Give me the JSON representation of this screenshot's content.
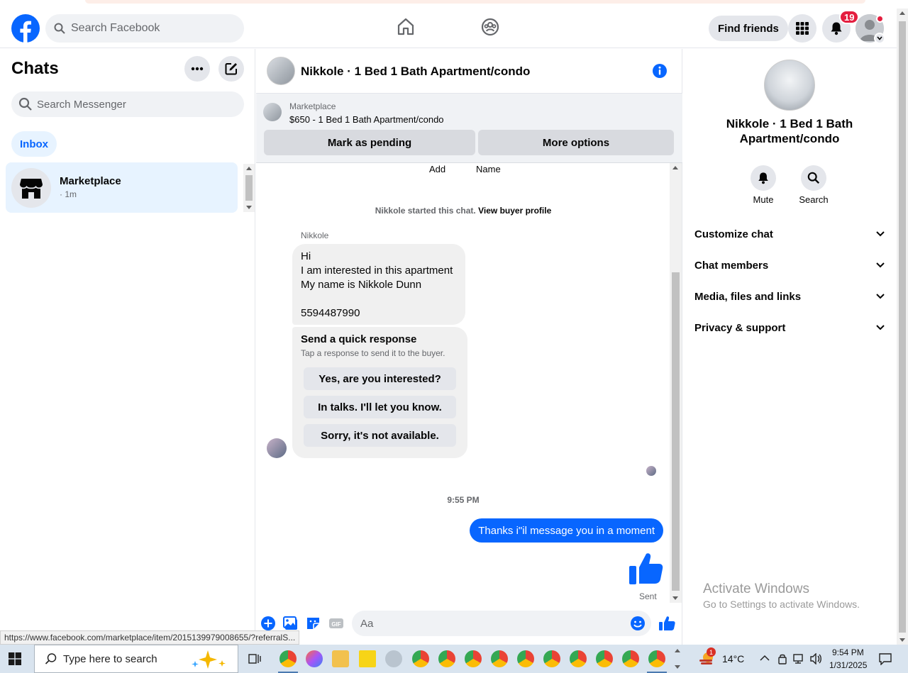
{
  "topnav": {
    "search_placeholder": "Search Facebook",
    "find_friends_label": "Find friends",
    "notification_count": "19",
    "brand_color": "#0866ff"
  },
  "left": {
    "title": "Chats",
    "search_placeholder": "Search Messenger",
    "inbox_label": "Inbox",
    "chat_item": {
      "name": "Marketplace",
      "time": "· 1m"
    }
  },
  "conversation": {
    "title": "Nikkole · 1 Bed 1 Bath Apartment/condo",
    "marketplace": {
      "label": "Marketplace",
      "listing": "$650 - 1 Bed 1 Bath Apartment/condo",
      "mark_pending_label": "Mark as pending",
      "more_options_label": "More options"
    },
    "top_labels": {
      "add": "Add",
      "name": "Name"
    },
    "started_text": "Nikkole started this chat.",
    "view_profile_link": "View buyer profile",
    "sender_name": "Nikkole",
    "incoming_lines": [
      "Hi",
      "I am interested in this apartment",
      "My name is Nikkole Dunn",
      "",
      "5594487990"
    ],
    "quick_response": {
      "title": "Send a quick response",
      "subtitle": "Tap a response to send it to the buyer.",
      "options": [
        "Yes, are you interested?",
        "In talks. I'll let you know.",
        "Sorry, it's not available."
      ]
    },
    "timestamp": "9:55 PM",
    "outgoing_message": "Thanks i\"il message you in a moment",
    "sent_label": "Sent",
    "composer_placeholder": "Aa"
  },
  "right": {
    "name": "Nikkole · 1 Bed 1 Bath Apartment/condo",
    "actions": [
      {
        "label": "Mute",
        "icon": "bell-icon"
      },
      {
        "label": "Search",
        "icon": "search-icon"
      }
    ],
    "sections": [
      "Customize chat",
      "Chat members",
      "Media, files and links",
      "Privacy & support"
    ],
    "activate_title": "Activate Windows",
    "activate_subtitle": "Go to Settings to activate Windows."
  },
  "status_url": "https://www.facebook.com/marketplace/item/2015139979008655/?referralS...",
  "taskbar": {
    "search_placeholder": "Type here to search",
    "weather": "14°C",
    "weather_badge": "1",
    "time": "9:54 PM",
    "date": "1/31/2025"
  }
}
